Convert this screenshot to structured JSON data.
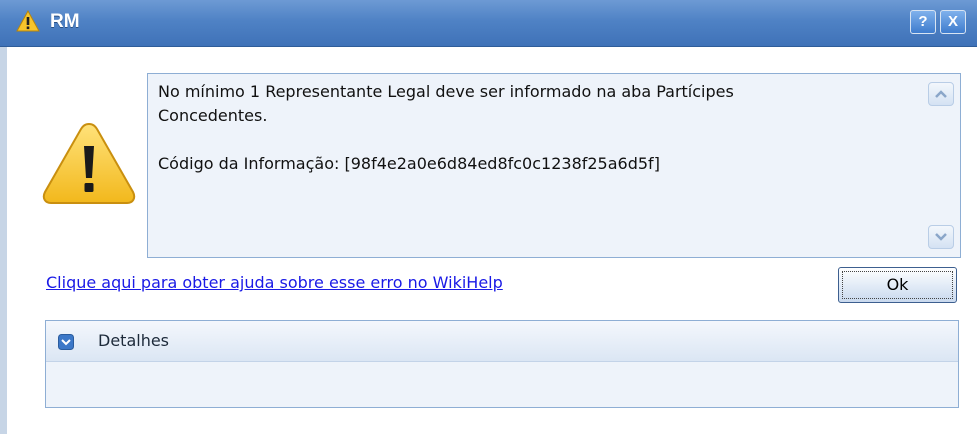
{
  "window": {
    "title": "RM",
    "help_button": "?",
    "close_button": "X"
  },
  "message": {
    "text": "No mínimo 1 Representante Legal deve ser informado na aba Partícipes\nConcedentes.\n\nCódigo da Informação: [98f4e2a0e6d84ed8fc0c1238f25a6d5f]"
  },
  "help_link": {
    "label": "Clique aqui para obter ajuda sobre esse erro no WikiHelp"
  },
  "ok_button": {
    "label": "Ok"
  },
  "details": {
    "label": "Detalhes"
  },
  "icons": {
    "title": "warning-icon",
    "main": "warning-icon",
    "scroll_up": "chevron-up-icon",
    "scroll_down": "chevron-down-icon",
    "details_toggle": "chevron-down-icon"
  },
  "colors": {
    "titlebar": "#4f82c5",
    "warning_yellow": "#f7c52b",
    "link": "#1a1ae6"
  }
}
